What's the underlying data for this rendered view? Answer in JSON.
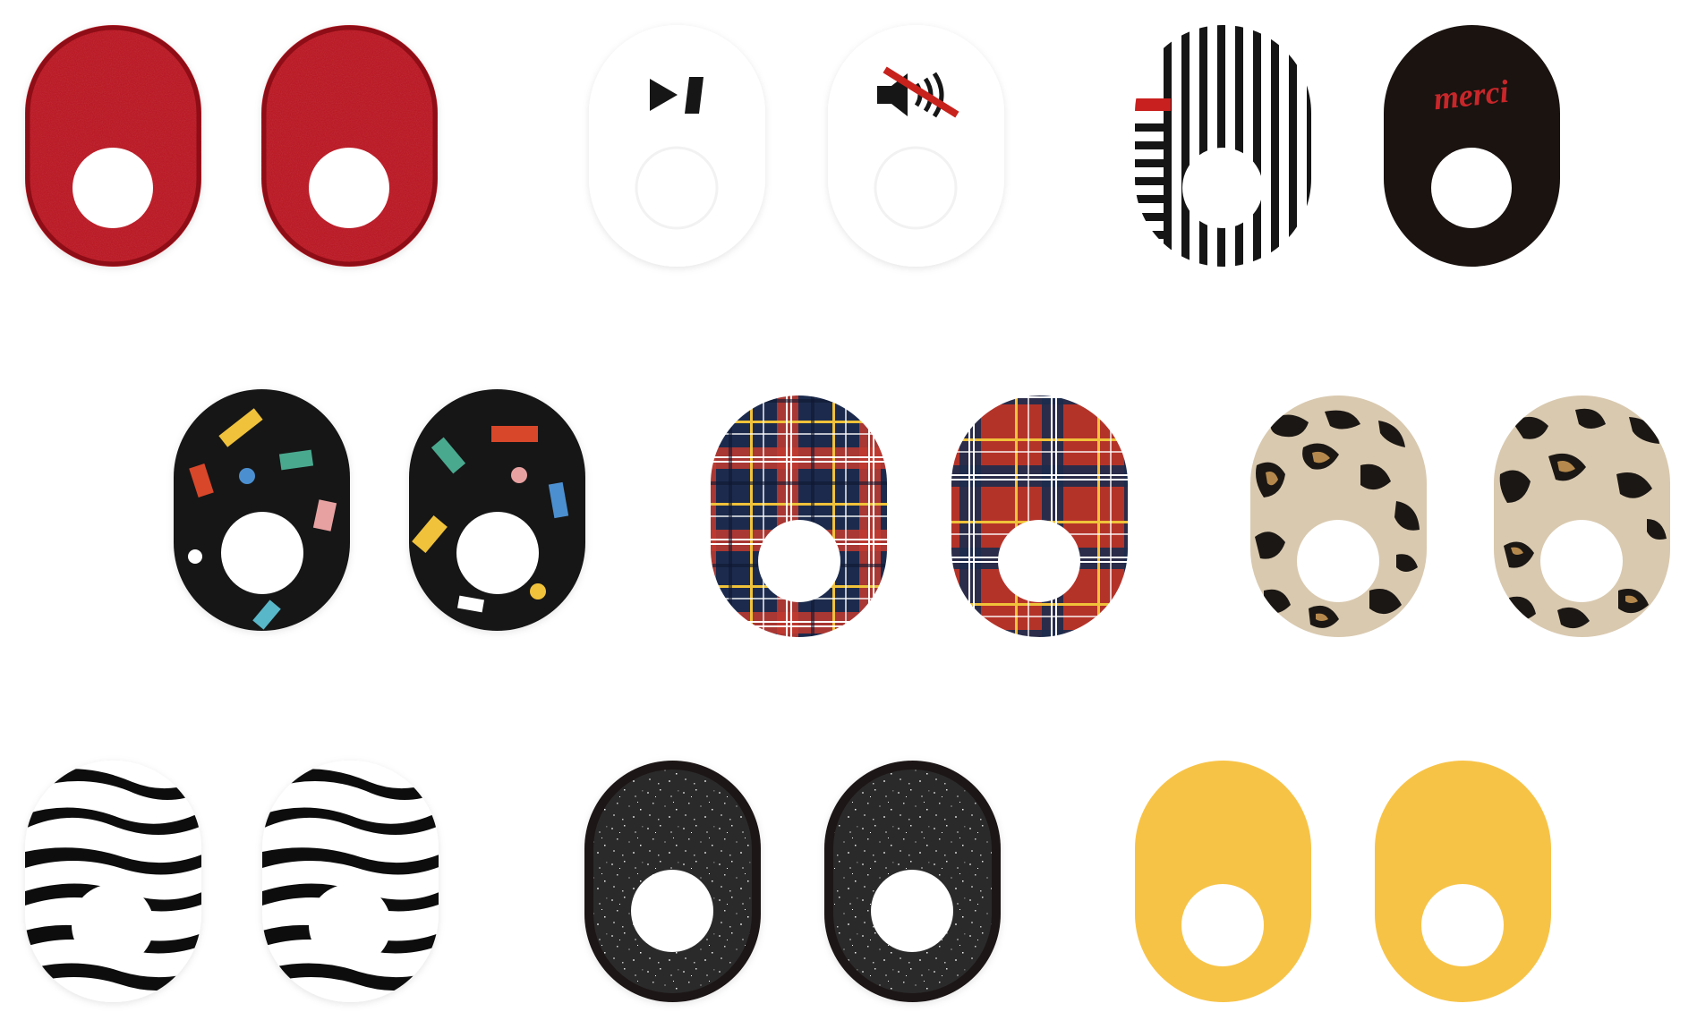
{
  "canvas": {
    "background": "#ffffff"
  },
  "colors": {
    "red_felt": "#b8151d",
    "red_felt_dark": "#8e0e14",
    "white": "#ffffff",
    "black": "#151515",
    "stripe_red": "#c8201e",
    "merci_red": "#c9262a",
    "confetti_bg": "#161616",
    "plaid_navy": "#1c2b4d",
    "plaid_red": "#c23a2f",
    "plaid_yellow": "#f0c23a",
    "leopard_bg": "#d9c9af",
    "leopard_spot": "#1b1714",
    "leopard_tan": "#b5894d",
    "glitter_bg": "#2c2c2c",
    "glitter_rim": "#1e1414",
    "yellow": "#f7c347"
  },
  "sets": [
    {
      "name": "red-felt",
      "pattern": "felt"
    },
    {
      "name": "white-media-icons",
      "pattern": "white",
      "icons": [
        "play-pause-icon",
        "mute-icon"
      ]
    },
    {
      "name": "stripes-and-merci",
      "pattern": "stripes",
      "text": "merci"
    },
    {
      "name": "confetti",
      "pattern": "confetti"
    },
    {
      "name": "tartan-plaid",
      "pattern": "plaid"
    },
    {
      "name": "leopard",
      "pattern": "leopard"
    },
    {
      "name": "zebra",
      "pattern": "zebra"
    },
    {
      "name": "black-glitter",
      "pattern": "glitter"
    },
    {
      "name": "yellow",
      "pattern": "solid-yellow"
    }
  ]
}
